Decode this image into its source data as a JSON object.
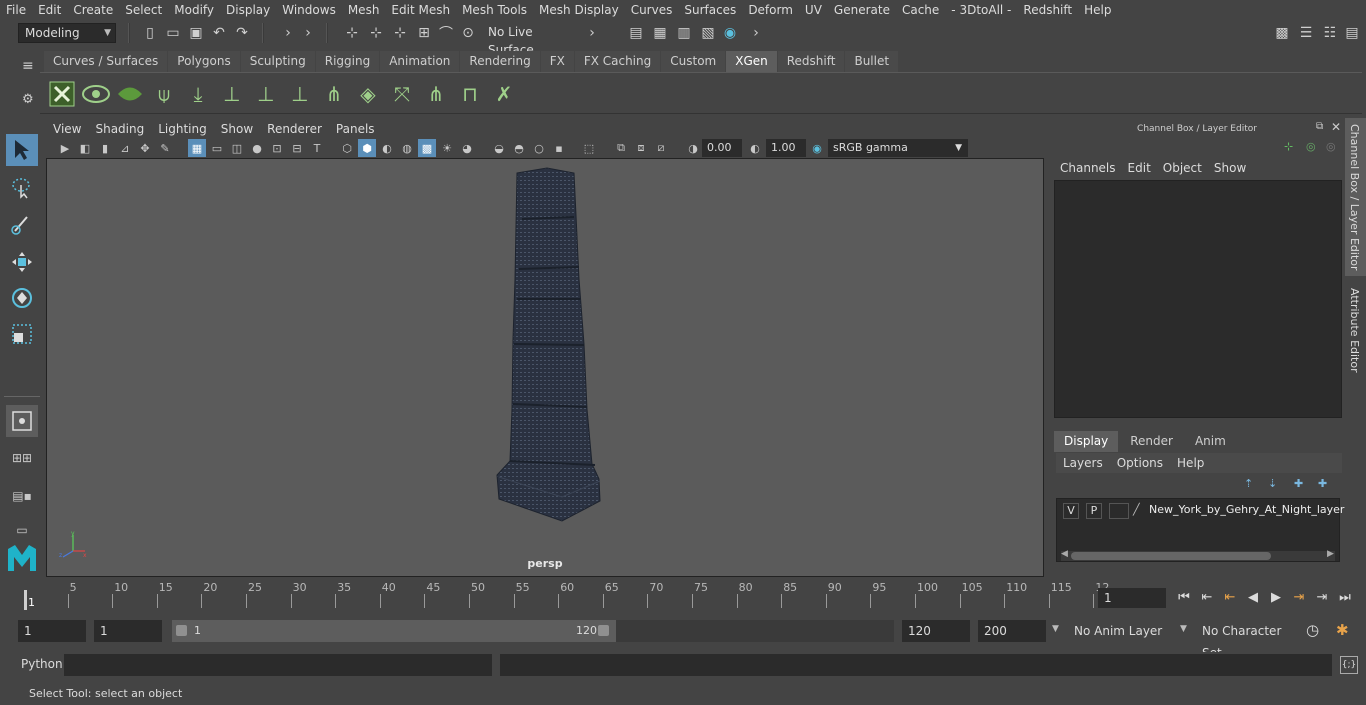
{
  "menubar": [
    "File",
    "Edit",
    "Create",
    "Select",
    "Modify",
    "Display",
    "Windows",
    "Mesh",
    "Edit Mesh",
    "Mesh Tools",
    "Mesh Display",
    "Curves",
    "Surfaces",
    "Deform",
    "UV",
    "Generate",
    "Cache",
    "- 3DtoAll -",
    "Redshift",
    "Help"
  ],
  "status": {
    "mode": "Modeling",
    "live_surface": "No Live Surface"
  },
  "shelf": {
    "tabs": [
      "Curves / Surfaces",
      "Polygons",
      "Sculpting",
      "Rigging",
      "Animation",
      "Rendering",
      "FX",
      "FX Caching",
      "Custom",
      "XGen",
      "Redshift",
      "Bullet"
    ],
    "active": "XGen"
  },
  "viewport": {
    "menu": [
      "View",
      "Shading",
      "Lighting",
      "Show",
      "Renderer",
      "Panels"
    ],
    "exposure": "0.00",
    "gamma": "1.00",
    "color_space": "sRGB gamma",
    "camera_label": "persp"
  },
  "right_panel": {
    "title": "Channel Box / Layer Editor",
    "menu": [
      "Channels",
      "Edit",
      "Object",
      "Show"
    ],
    "layer_tabs": [
      "Display",
      "Render",
      "Anim"
    ],
    "layer_tab_active": "Display",
    "layer_menu": [
      "Layers",
      "Options",
      "Help"
    ],
    "layer": {
      "v": "V",
      "p": "P",
      "name": "New_York_by_Gehry_At_Night_layer"
    },
    "side_tabs": [
      "Channel Box / Layer Editor",
      "Attribute Editor"
    ]
  },
  "timeline": {
    "ticks": [
      "1",
      "5",
      "10",
      "15",
      "20",
      "25",
      "30",
      "35",
      "40",
      "45",
      "50",
      "55",
      "60",
      "65",
      "70",
      "75",
      "80",
      "85",
      "90",
      "95",
      "100",
      "105",
      "110",
      "115",
      "12"
    ],
    "current_frame": "1"
  },
  "range": {
    "start": "1",
    "start2": "1",
    "slider_start": "1",
    "slider_end": "120",
    "end": "120",
    "end2": "200",
    "anim_layer": "No Anim Layer",
    "character_set": "No Character Set"
  },
  "command": {
    "label": "Python"
  },
  "helpline": "Select Tool: select an object"
}
